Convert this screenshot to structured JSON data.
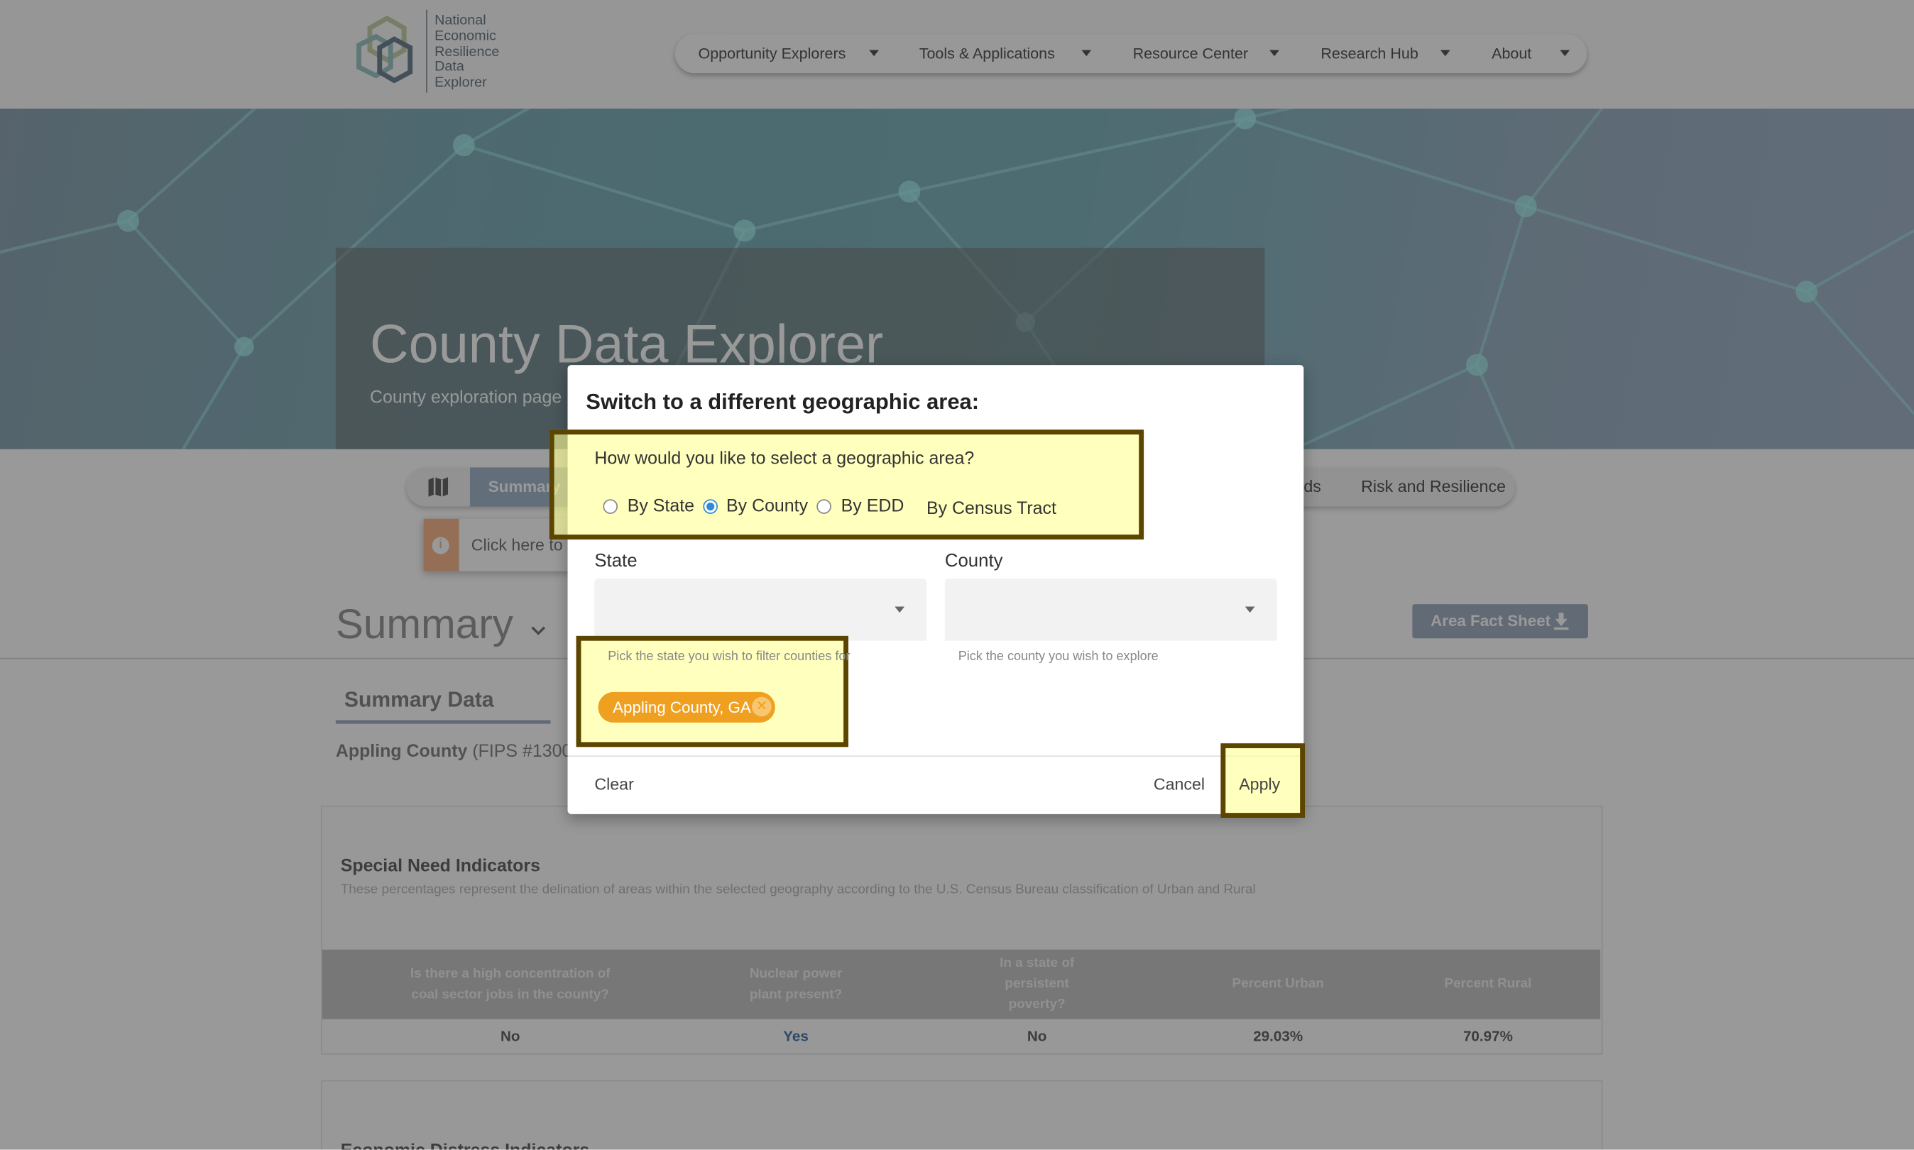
{
  "header": {
    "logo_text": [
      "National",
      "Economic",
      "Resilience",
      "Data",
      "Explorer"
    ],
    "nav": [
      {
        "label": "Opportunity Explorers"
      },
      {
        "label": "Tools & Applications"
      },
      {
        "label": "Resource Center"
      },
      {
        "label": "Research Hub"
      },
      {
        "label": "About"
      }
    ]
  },
  "hero": {
    "title": "County Data Explorer",
    "subtitle": "County exploration page"
  },
  "tabs": {
    "active": "Summary",
    "partial": "ds",
    "last": "Risk and Resilience"
  },
  "tooltip": {
    "text": "Click here to"
  },
  "section": {
    "title": "Summary",
    "fact_sheet": "Area Fact Sheet",
    "subtab": "Summary Data",
    "county_name": "Appling County",
    "fips": "(FIPS #1300"
  },
  "special_need": {
    "title": "Special Need Indicators",
    "description": "These percentages represent the delination of areas within the selected geography according to the U.S. Census Bureau classification of Urban and Rural",
    "columns": [
      "Is there a high concentration of coal sector jobs in the county?",
      "Nuclear power plant present?",
      "In a state of persistent poverty?",
      "Percent Urban",
      "Percent Rural"
    ],
    "row": [
      "No",
      "Yes",
      "No",
      "29.03%",
      "70.97%"
    ]
  },
  "economic_distress": {
    "title": "Economic Distress Indicators"
  },
  "modal": {
    "title": "Switch to a different geographic area:",
    "question": "How would you like to select a geographic area?",
    "options": [
      "By State",
      "By County",
      "By EDD",
      "By Census Tract"
    ],
    "selected_option": "By County",
    "state_label": "State",
    "state_value": "",
    "state_helper": "Pick the state you wish to filter counties for",
    "county_label": "County",
    "county_value": "",
    "county_helper": "Pick the county you wish to explore",
    "chip": "Appling County, GA",
    "clear": "Clear",
    "cancel": "Cancel",
    "apply": "Apply"
  },
  "colors": {
    "chip": "#f0a020",
    "highlight_border": "#5c4500",
    "highlight_fill": "#ffffc0",
    "radio_selected": "#2d8ad6",
    "link_yes": "#4a78b0"
  }
}
